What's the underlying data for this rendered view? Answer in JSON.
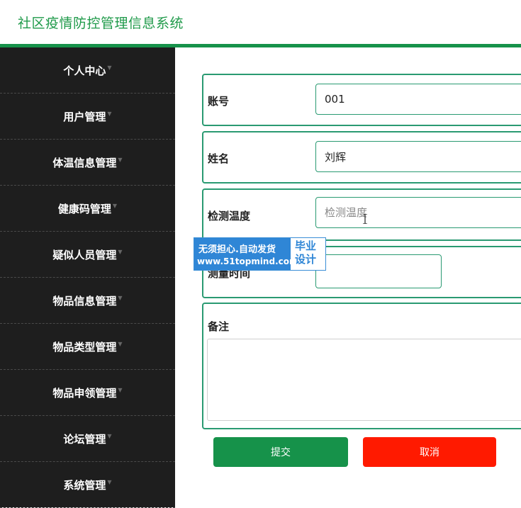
{
  "app": {
    "title": "社区疫情防控管理信息系统"
  },
  "sidebar": {
    "items": [
      {
        "label": "个人中心"
      },
      {
        "label": "用户管理"
      },
      {
        "label": "体温信息管理"
      },
      {
        "label": "健康码管理"
      },
      {
        "label": "疑似人员管理"
      },
      {
        "label": "物品信息管理"
      },
      {
        "label": "物品类型管理"
      },
      {
        "label": "物品申领管理"
      },
      {
        "label": "论坛管理"
      },
      {
        "label": "系统管理"
      }
    ]
  },
  "form": {
    "account": {
      "label": "账号",
      "value": "001"
    },
    "name": {
      "label": "姓名",
      "value": "刘辉"
    },
    "temperature": {
      "label": "检测温度",
      "placeholder": "检测温度"
    },
    "measure_time": {
      "label": "测量时间",
      "value": ""
    },
    "remark": {
      "label": "备注",
      "value": ""
    },
    "submit_label": "提交",
    "cancel_label": "取消"
  },
  "watermark": {
    "line1": "无须担心.自动发货",
    "line2": "www.51topmind.com",
    "badge_line1": "毕业",
    "badge_line2": "设计"
  },
  "colors": {
    "accent": "#16924a",
    "sidebar_bg": "#1e1e1e",
    "field_border": "#2a9a72",
    "cancel": "#ff1a00",
    "watermark": "#2f86d6"
  }
}
